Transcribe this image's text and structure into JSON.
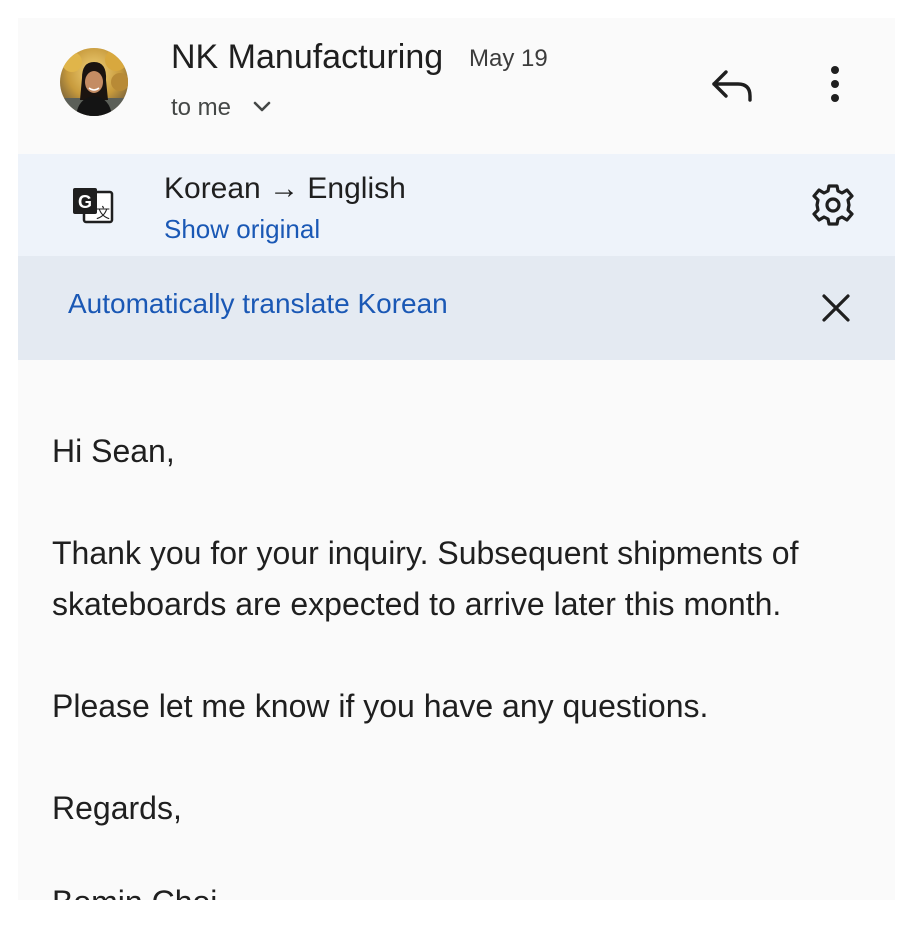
{
  "header": {
    "sender_name": "NK Manufacturing",
    "date": "May 19",
    "recipient_label": "to me",
    "icons": {
      "avatar": "profile-photo",
      "recipient_toggle": "chevron-down-icon",
      "reply": "reply-arrow-icon",
      "more": "more-vert-icon"
    }
  },
  "translation": {
    "language_pair": "Korean → English",
    "show_original_label": "Show original",
    "icons": {
      "translate": "google-translate-icon",
      "settings": "gear-icon"
    }
  },
  "auto_translate": {
    "label": "Automatically translate Korean",
    "close_icon": "close-icon"
  },
  "email": {
    "greeting": "Hi Sean,",
    "paragraph_1": "Thank you for your inquiry. Subsequent shipments of skateboards are expected to arrive later this month.",
    "paragraph_2": "Please let me know if you have any questions.",
    "closing": "Regards,",
    "signature": "Bomin Choi"
  },
  "colors": {
    "link_blue": "#1a58b5",
    "translate_bar_bg": "#eef3fa",
    "auto_bar_bg": "#e4eaf2",
    "text": "#1f1f1f"
  }
}
